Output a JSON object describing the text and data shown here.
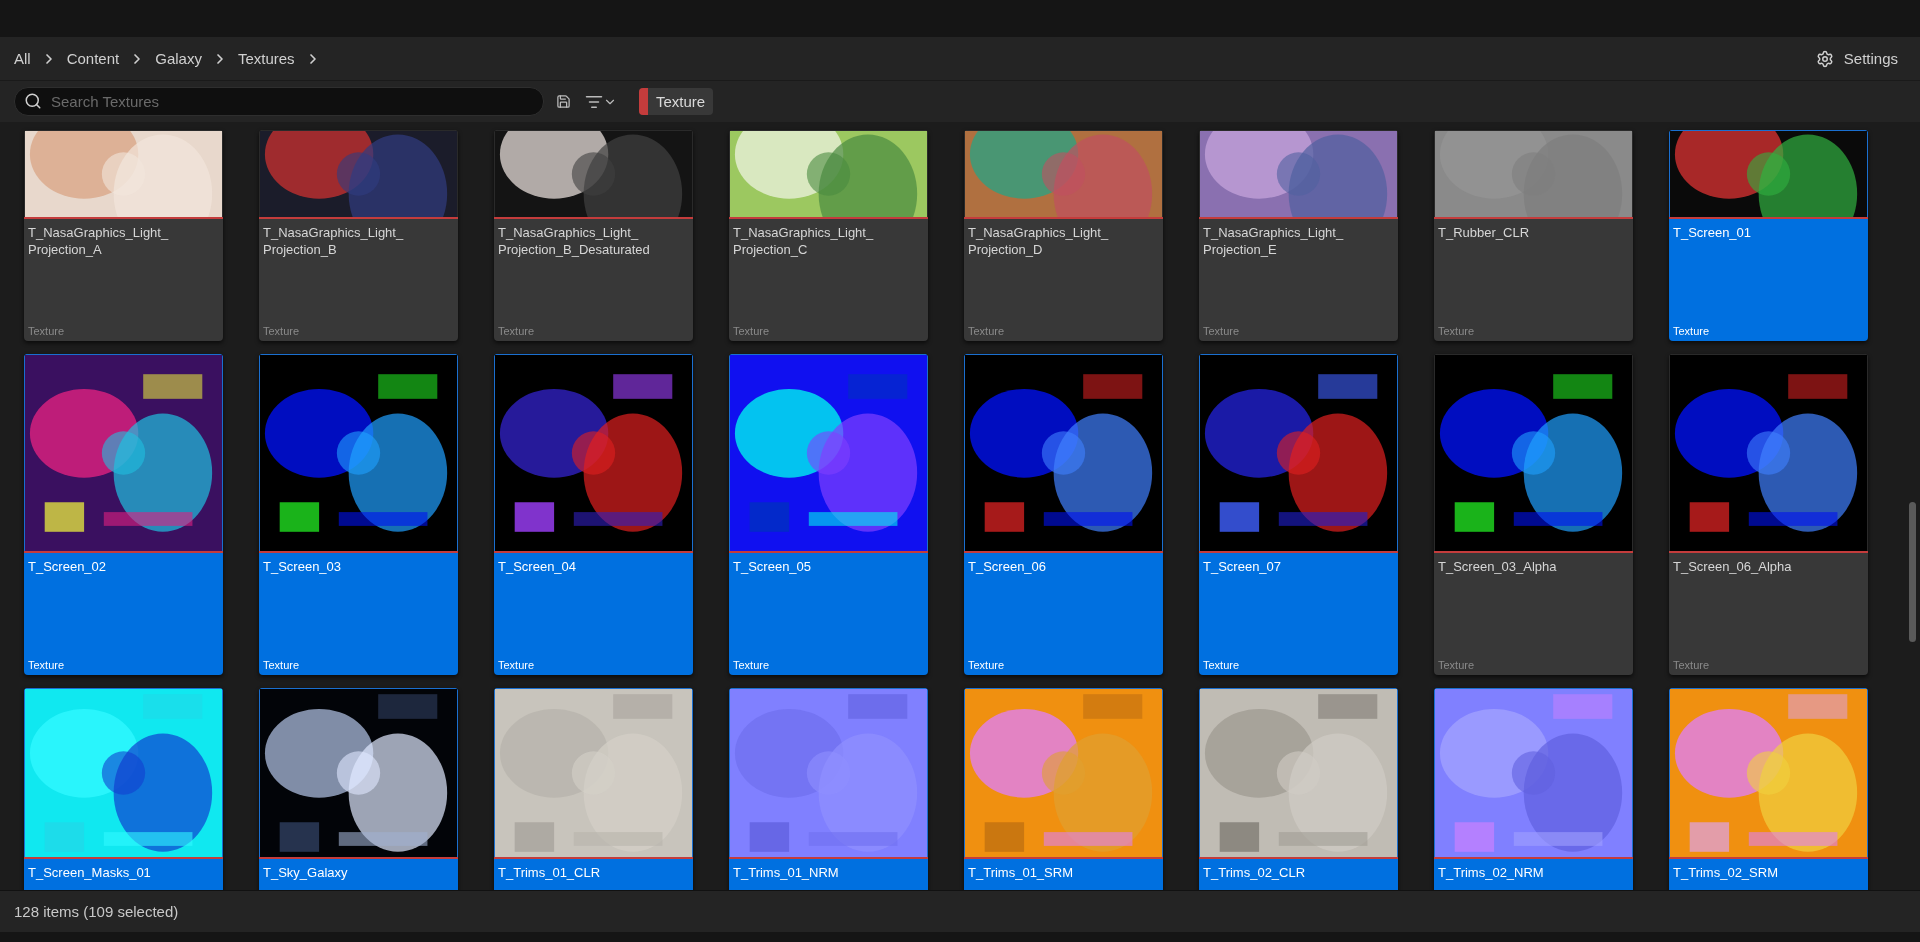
{
  "breadcrumb": [
    "All",
    "Content",
    "Galaxy",
    "Textures"
  ],
  "settings": "Settings",
  "search": {
    "placeholder": "Search Textures"
  },
  "filter_chip": {
    "label": "Texture",
    "color": "#c43c3c"
  },
  "rows": [
    {
      "items": [
        {
          "name": "T_NasaGraphics_Light_\nProjection_A",
          "type": "Texture",
          "selected": false
        },
        {
          "name": "T_NasaGraphics_Light_\nProjection_B",
          "type": "Texture",
          "selected": false
        },
        {
          "name": "T_NasaGraphics_Light_\nProjection_B_Desaturated",
          "type": "Texture",
          "selected": false
        },
        {
          "name": "T_NasaGraphics_Light_\nProjection_C",
          "type": "Texture",
          "selected": false
        },
        {
          "name": "T_NasaGraphics_Light_\nProjection_D",
          "type": "Texture",
          "selected": false
        },
        {
          "name": "T_NasaGraphics_Light_\nProjection_E",
          "type": "Texture",
          "selected": false
        },
        {
          "name": "T_Rubber_CLR",
          "type": "Texture",
          "selected": false
        },
        {
          "name": "T_Screen_01",
          "type": "Texture",
          "selected": true
        }
      ]
    },
    {
      "items": [
        {
          "name": "T_Screen_02",
          "type": "Texture",
          "selected": true
        },
        {
          "name": "T_Screen_03",
          "type": "Texture",
          "selected": true
        },
        {
          "name": "T_Screen_04",
          "type": "Texture",
          "selected": true
        },
        {
          "name": "T_Screen_05",
          "type": "Texture",
          "selected": true
        },
        {
          "name": "T_Screen_06",
          "type": "Texture",
          "selected": true
        },
        {
          "name": "T_Screen_07",
          "type": "Texture",
          "selected": true
        },
        {
          "name": "T_Screen_03_Alpha",
          "type": "Texture",
          "selected": false
        },
        {
          "name": "T_Screen_06_Alpha",
          "type": "Texture",
          "selected": false
        }
      ]
    },
    {
      "items": [
        {
          "name": "T_Screen_Masks_01",
          "selected": true
        },
        {
          "name": "T_Sky_Galaxy",
          "selected": true
        },
        {
          "name": "T_Trims_01_CLR",
          "selected": true
        },
        {
          "name": "T_Trims_01_NRM",
          "selected": true
        },
        {
          "name": "T_Trims_01_SRM",
          "selected": true
        },
        {
          "name": "T_Trims_02_CLR",
          "selected": true
        },
        {
          "name": "T_Trims_02_NRM",
          "selected": true
        },
        {
          "name": "T_Trims_02_SRM",
          "selected": true
        }
      ]
    }
  ],
  "status": "128 items (109 selected)"
}
